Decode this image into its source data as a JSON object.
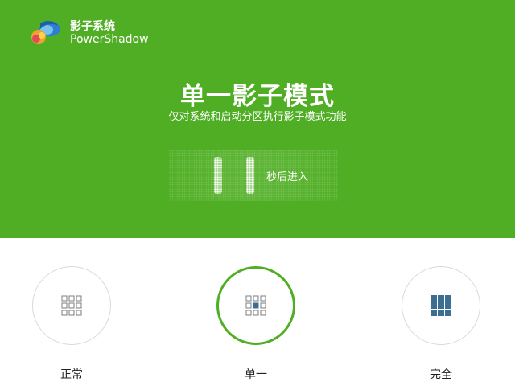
{
  "app": {
    "name_cn": "影子系统",
    "name_en": "PowerShadow"
  },
  "mode": {
    "title": "单一影子模式",
    "description": "仅对系统和启动分区执行影子模式功能"
  },
  "countdown": {
    "value": "11",
    "text": "秒后进入"
  },
  "modes": [
    {
      "label": "正常",
      "icon": "grid-outline-icon",
      "selected": false
    },
    {
      "label": "单一",
      "icon": "grid-center-filled-icon",
      "selected": true
    },
    {
      "label": "完全",
      "icon": "grid-filled-icon",
      "selected": false
    }
  ],
  "colors": {
    "primary_green": "#4fae23",
    "icon_blue": "#3c6e91",
    "outline_gray": "#d9d9d9"
  }
}
